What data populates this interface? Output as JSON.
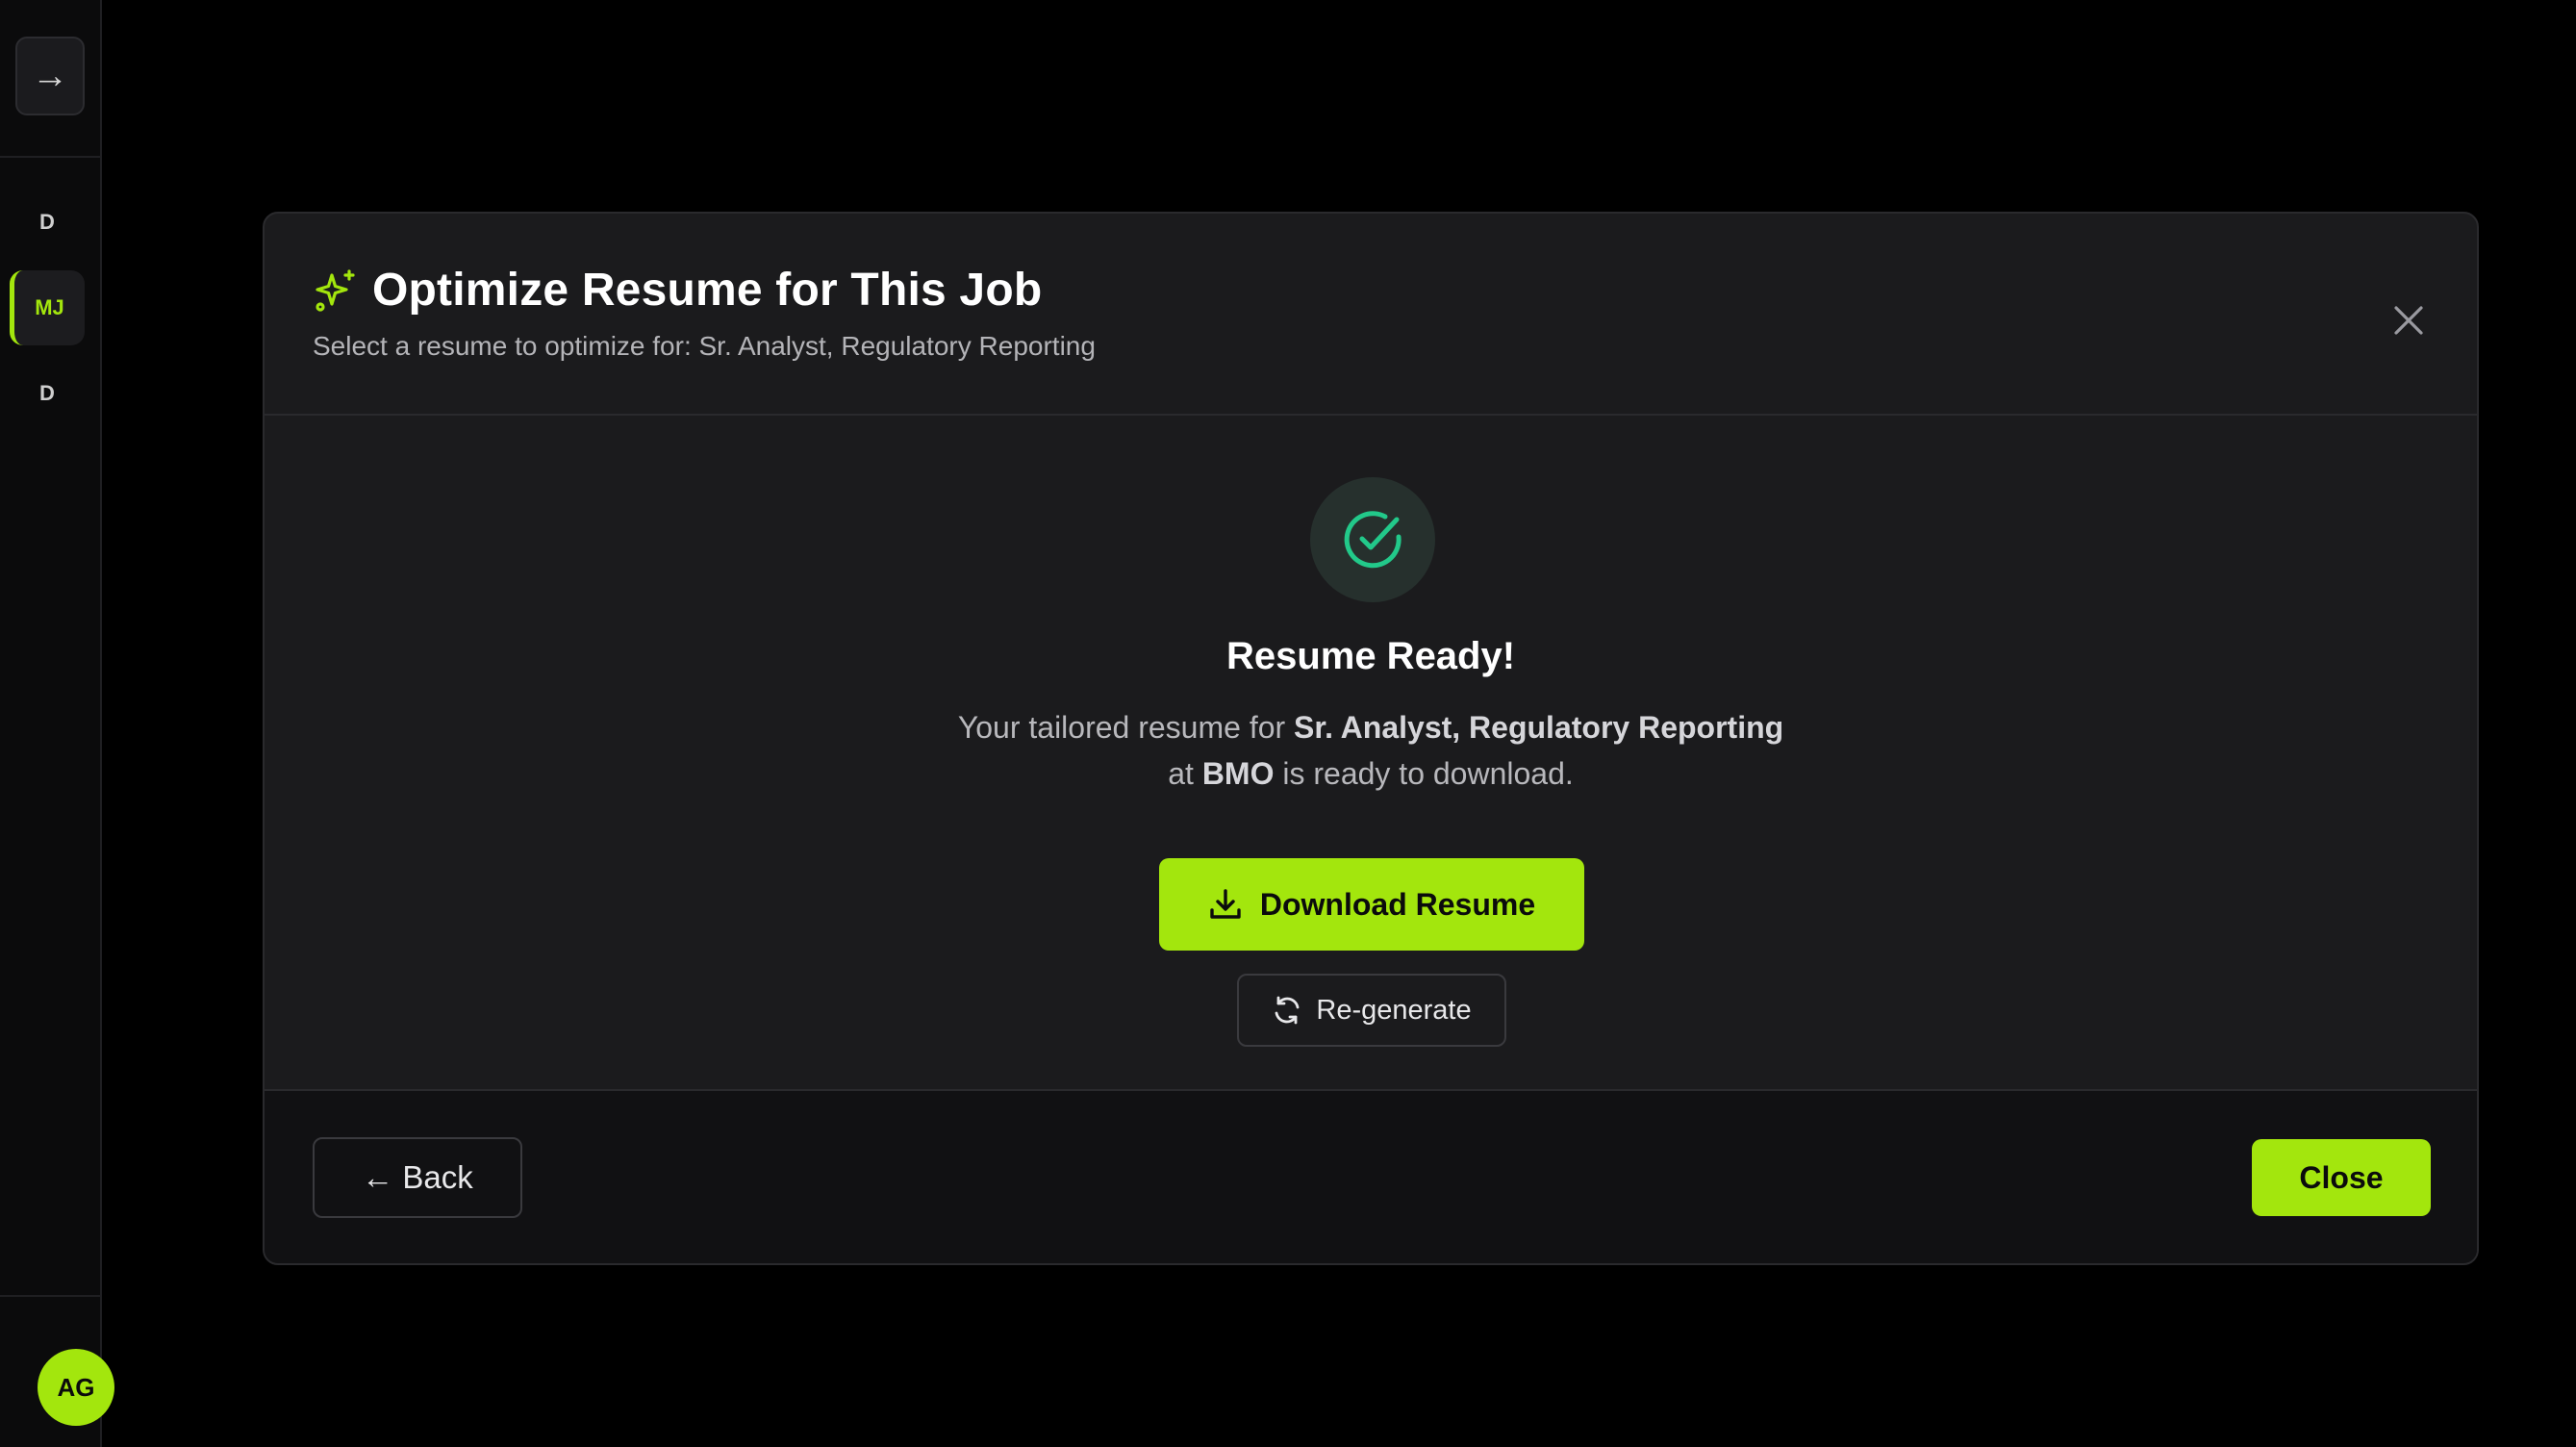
{
  "sidebar": {
    "toggle_glyph": "→",
    "items": [
      {
        "label": "D",
        "active": false
      },
      {
        "label": "MJ",
        "active": true
      },
      {
        "label": "D",
        "active": false
      }
    ],
    "avatar_initials": "AG"
  },
  "modal": {
    "title": "Optimize Resume for This Job",
    "subtitle": "Select a resume to optimize for: Sr. Analyst, Regulatory Reporting",
    "body": {
      "status_title": "Resume Ready!",
      "desc_prefix": "Your tailored resume for",
      "job_title": "Sr. Analyst, Regulatory Reporting",
      "desc_at": "at",
      "company": "BMO",
      "desc_suffix": "is ready to download.",
      "download_label": "Download Resume",
      "regenerate_label": "Re-generate"
    },
    "footer": {
      "back_label": "← Back",
      "close_label": "Close"
    }
  },
  "colors": {
    "accent": "#a3e60d",
    "success": "#22c98a",
    "modal_bg": "#1b1b1d",
    "page_bg": "#000000"
  },
  "icons": {
    "header": "sparkles-icon",
    "status": "check-circle-icon",
    "download": "download-icon",
    "regenerate": "refresh-icon",
    "close": "close-icon"
  }
}
